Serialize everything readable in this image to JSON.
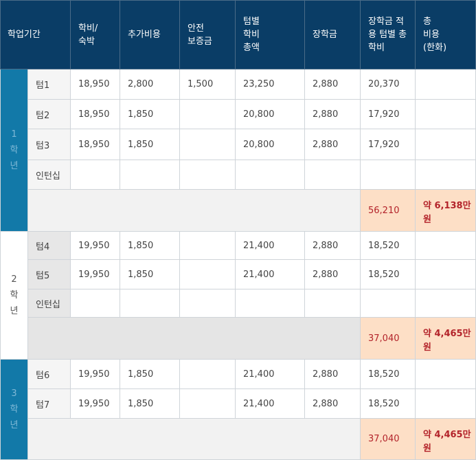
{
  "headers": [
    "학업기간",
    "학비/\n숙박",
    "추가비용",
    "안전\n보증금",
    "텀별\n학비\n총액",
    "장학금",
    "장학금 적\n용 텀별 총\n학비",
    "총\n비용\n(한화)"
  ],
  "year1": {
    "label": "1\n학\n년",
    "rows": [
      {
        "term": "텀1",
        "tuition": "18,950",
        "extra": "2,800",
        "deposit": "1,500",
        "total": "23,250",
        "scholarship": "2,880",
        "net": "20,370",
        "krw": ""
      },
      {
        "term": "텀2",
        "tuition": "18,950",
        "extra": "1,850",
        "deposit": "",
        "total": "20,800",
        "scholarship": "2,880",
        "net": "17,920",
        "krw": ""
      },
      {
        "term": "텀3",
        "tuition": "18,950",
        "extra": "1,850",
        "deposit": "",
        "total": "20,800",
        "scholarship": "2,880",
        "net": "17,920",
        "krw": ""
      },
      {
        "term": "인턴십",
        "tuition": "",
        "extra": "",
        "deposit": "",
        "total": "",
        "scholarship": "",
        "net": "",
        "krw": ""
      }
    ],
    "sum_net": "56,210",
    "sum_krw": "약 6,138만\n원"
  },
  "year2": {
    "label": "2\n학\n년",
    "rows": [
      {
        "term": "텀4",
        "tuition": "19,950",
        "extra": "1,850",
        "deposit": "",
        "total": "21,400",
        "scholarship": "2,880",
        "net": "18,520",
        "krw": ""
      },
      {
        "term": "텀5",
        "tuition": "19,950",
        "extra": "1,850",
        "deposit": "",
        "total": "21,400",
        "scholarship": "2,880",
        "net": "18,520",
        "krw": ""
      },
      {
        "term": "인턴십",
        "tuition": "",
        "extra": "",
        "deposit": "",
        "total": "",
        "scholarship": "",
        "net": "",
        "krw": ""
      }
    ],
    "sum_net": "37,040",
    "sum_krw": "약 4,465만\n원"
  },
  "year3": {
    "label": "3\n학\n년",
    "rows": [
      {
        "term": "텀6",
        "tuition": "19,950",
        "extra": "1,850",
        "deposit": "",
        "total": "21,400",
        "scholarship": "2,880",
        "net": "18,520",
        "krw": ""
      },
      {
        "term": "텀7",
        "tuition": "19,950",
        "extra": "1,850",
        "deposit": "",
        "total": "21,400",
        "scholarship": "2,880",
        "net": "18,520",
        "krw": ""
      }
    ],
    "sum_net": "37,040",
    "sum_krw": "약 4,465만\n원"
  },
  "colors": {
    "header_bg": "#0a3d66",
    "year_bg": "#1279a8",
    "highlight_bg": "#fddfc6",
    "highlight_text": "#b3232a"
  }
}
